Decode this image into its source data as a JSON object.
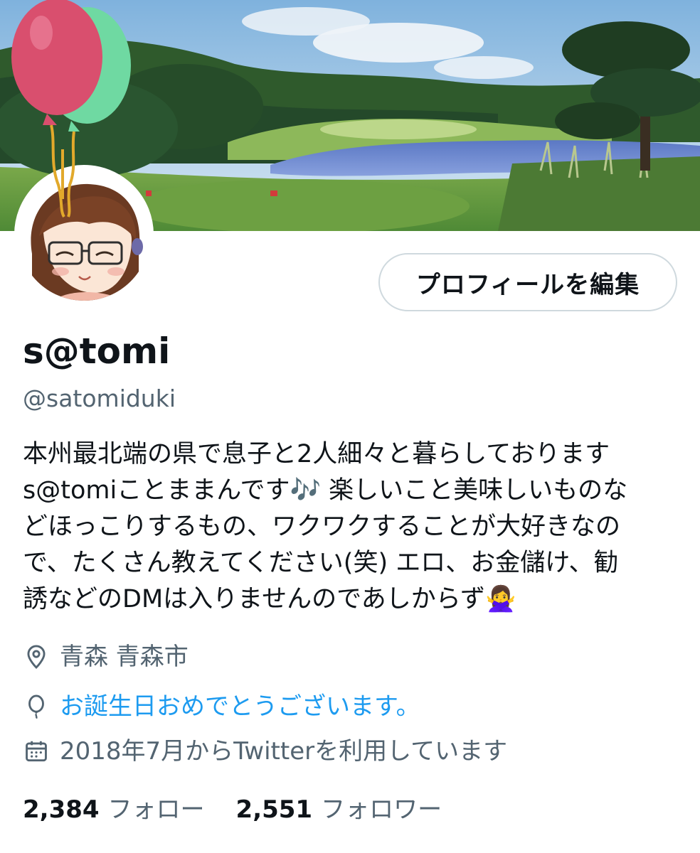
{
  "profile": {
    "display_name": "s@tomi",
    "handle": "@satomiduki",
    "edit_button_label": "プロフィールを編集",
    "bio_lines": [
      "本州最北端の県で息子と2人細々と暮らしております",
      "s@tomiことままんです🎶 楽しいこと美味しいものな",
      "どほっこりするもの、ワクワクすることが大好きなの",
      "で、たくさん教えてください(笑) エロ、お金儲け、勧",
      "誘などのDMは入りませんのであしからず🙅‍♀️"
    ],
    "location": "青森 青森市",
    "birthday": "お誕生日おめでとうございます。",
    "joined": "2018年7月からTwitterを利用しています"
  },
  "stats": {
    "following_count": "2,384",
    "following_label": "フォロー",
    "followers_count": "2,551",
    "followers_label": "フォロワー"
  },
  "icons": {
    "location": "location-pin-icon",
    "birthday": "balloon-icon",
    "joined": "calendar-icon"
  },
  "colors": {
    "link": "#1d9bf0",
    "secondary_text": "#536471",
    "primary_text": "#0f1419",
    "button_border": "#cfd9de"
  }
}
